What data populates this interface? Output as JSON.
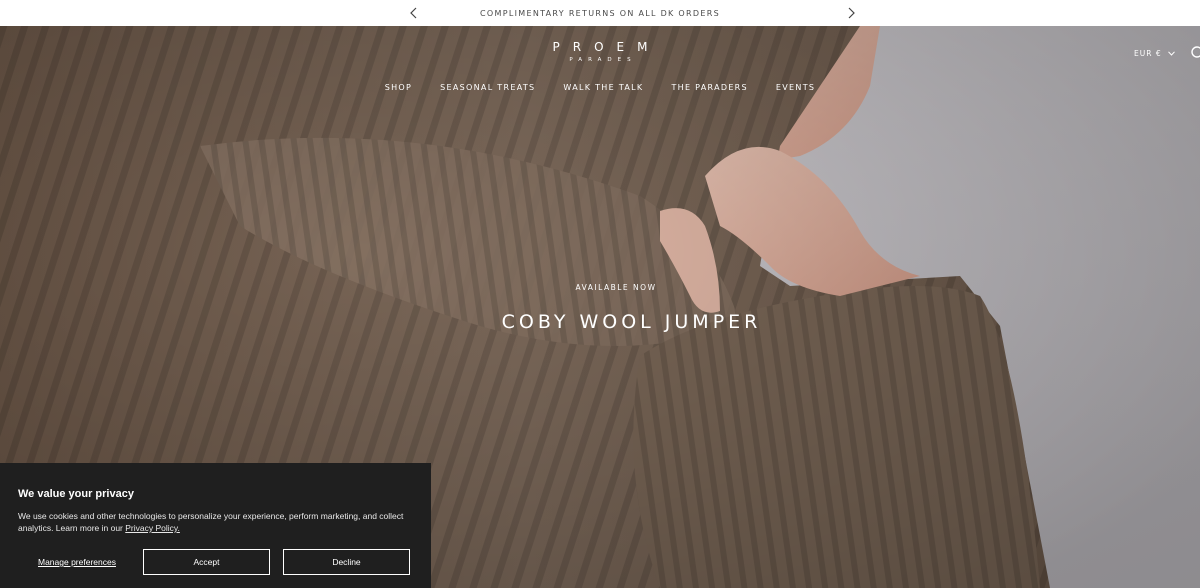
{
  "announcement": {
    "text": "COMPLIMENTARY RETURNS ON ALL DK ORDERS",
    "prev_icon": "chevron-left-icon",
    "next_icon": "chevron-right-icon"
  },
  "header": {
    "logo_main": "PROEM",
    "logo_sub": "PARADES",
    "nav": [
      "SHOP",
      "SEASONAL TREATS",
      "WALK THE TALK",
      "THE PARADERS",
      "EVENTS"
    ],
    "currency": "EUR €",
    "search_icon": "search-icon"
  },
  "hero": {
    "eyebrow": "AVAILABLE NOW",
    "title": "COBY WOOL JUMPER"
  },
  "cookie_banner": {
    "title": "We value your privacy",
    "text": "We use cookies and other technologies to personalize your experience, perform marketing, and collect analytics. Learn more in our ",
    "policy_link": "Privacy Policy.",
    "manage": "Manage preferences",
    "accept": "Accept",
    "decline": "Decline"
  },
  "colors": {
    "cookie_bg": "#1f1f1f",
    "sweater": "#7a6656",
    "backdrop": "#c8c5c9"
  }
}
